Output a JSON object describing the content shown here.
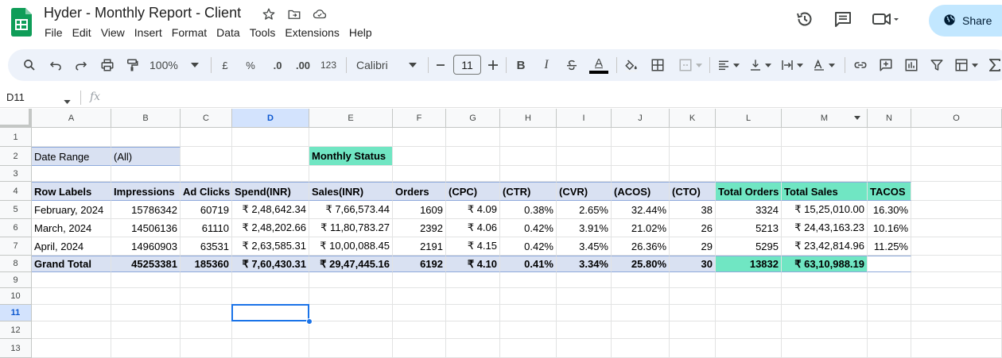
{
  "doc": {
    "title": "Hyder - Monthly Report - Client",
    "menu": [
      "File",
      "Edit",
      "View",
      "Insert",
      "Format",
      "Data",
      "Tools",
      "Extensions",
      "Help"
    ],
    "share_label": "Share"
  },
  "toolbar": {
    "zoom": "100%",
    "currency_symbol": "£",
    "percent_symbol": "%",
    "decrease_decimal": ".0",
    "increase_decimal": ".00",
    "more_formats": "123",
    "font": "Calibri",
    "font_size": "11",
    "bold": "B",
    "italic": "I",
    "text_color_letter": "A"
  },
  "formula_bar": {
    "name_box": "D11",
    "fx": "fx",
    "content": ""
  },
  "grid": {
    "columns": [
      "A",
      "B",
      "C",
      "D",
      "E",
      "F",
      "G",
      "H",
      "I",
      "J",
      "K",
      "L",
      "M",
      "N",
      "O"
    ],
    "rows": [
      "1",
      "2",
      "3",
      "4",
      "5",
      "6",
      "7",
      "8",
      "9",
      "10",
      "11",
      "12",
      "13"
    ],
    "selected_column": "D",
    "selected_row": "11",
    "cells": {
      "A2": "Date Range",
      "B2": "(All)",
      "E2": "Monthly Status",
      "headers": [
        "Row Labels",
        "Impressions",
        "Ad Clicks",
        "Spend(INR)",
        "Sales(INR)",
        "Orders",
        "(CPC)",
        "(CTR)",
        "(CVR)",
        "(ACOS)",
        "(CTO)",
        "Total Orders",
        "Total Sales",
        "TACOS"
      ],
      "data_rows": [
        [
          "February, 2024",
          "15786342",
          "60719",
          "₹ 2,48,642.34",
          "₹ 7,66,573.44",
          "1609",
          "₹ 4.09",
          "0.38%",
          "2.65%",
          "32.44%",
          "38",
          "3324",
          "₹ 15,25,010.00",
          "16.30%"
        ],
        [
          "March, 2024",
          "14506136",
          "61110",
          "₹ 2,48,202.66",
          "₹ 11,80,783.27",
          "2392",
          "₹ 4.06",
          "0.42%",
          "3.91%",
          "21.02%",
          "26",
          "5213",
          "₹ 24,43,163.23",
          "10.16%"
        ],
        [
          "April, 2024",
          "14960903",
          "63531",
          "₹ 2,63,585.31",
          "₹ 10,00,088.45",
          "2191",
          "₹ 4.15",
          "0.42%",
          "3.45%",
          "26.36%",
          "29",
          "5295",
          "₹ 23,42,814.96",
          "11.25%"
        ],
        [
          "Grand Total",
          "45253381",
          "185360",
          "₹ 7,60,430.31",
          "₹ 29,47,445.16",
          "6192",
          "₹ 4.10",
          "0.41%",
          "3.34%",
          "25.80%",
          "30",
          "13832",
          "₹ 63,10,988.19",
          ""
        ]
      ]
    }
  },
  "colors": {
    "header_fill": "#d9e1f2",
    "highlight_fill": "#70e6c3",
    "selection": "#1a73e8",
    "share_bg": "#c2e7ff",
    "toolbar_bg": "#edf2fa"
  }
}
